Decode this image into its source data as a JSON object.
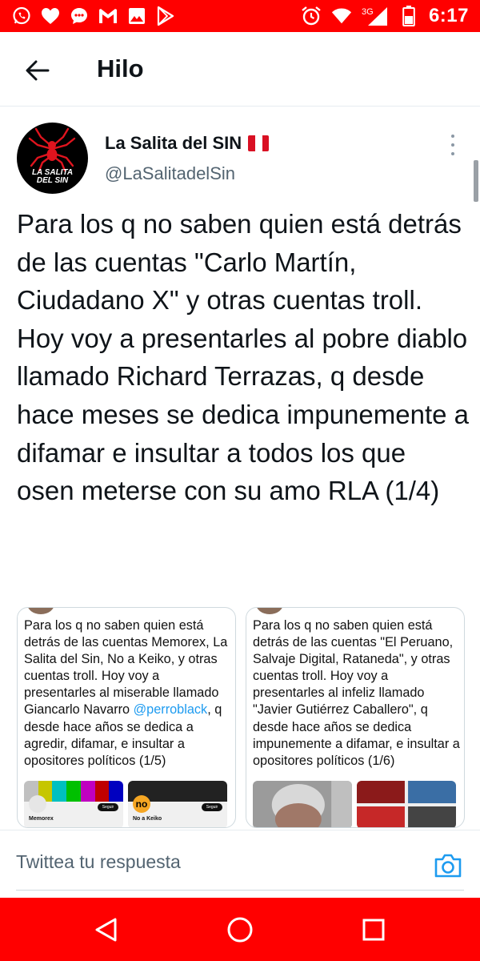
{
  "status_bar": {
    "time": "6:17",
    "network": "3G",
    "left_icons": [
      "whatsapp-icon",
      "heart-icon",
      "message-bubble-icon",
      "gmail-icon",
      "gallery-icon",
      "play-store-icon"
    ],
    "right_icons": [
      "alarm-icon",
      "wifi-icon",
      "signal-icon",
      "battery-icon"
    ],
    "bar_color": "#ff0000"
  },
  "header": {
    "title": "Hilo",
    "back_icon": "arrow-left-icon"
  },
  "tweet": {
    "avatar_label": "LA SALITA DEL SIN",
    "display_name": "La Salita del SIN",
    "handle": "@LaSalitadelSin",
    "text": "Para los q no saben quien está detrás de las cuentas \"Carlo Martín, Ciudadano X\" y otras cuentas troll. Hoy voy a presentarles al pobre diablo llamado Richard Terrazas, q desde hace meses se dedica impunemente a difamar e insultar a todos los que osen meterse con su amo RLA (1/4)"
  },
  "media": [
    {
      "text_before": "Para los q no saben quien está detrás de las cuentas Memorex, La Salita del Sin, No a Keiko, y otras cuentas troll. Hoy voy a presentarles al miserable llamado Giancarlo Navarro ",
      "link": "@perroblack",
      "text_after": ", q desde hace años se dedica a agredir, difamar, e insultar a opositores políticos (1/5)",
      "thumb1_label": "Memorex",
      "thumb2_label": "No a Keiko",
      "button_label": "Seguir"
    },
    {
      "text": "Para los q no saben quien está detrás de las cuentas \"El Peruano, Salvaje Digital, Rataneda\", y otras cuentas troll. Hoy voy a presentarles al infeliz llamado \"Javier Gutiérrez Caballero\", q desde hace años se dedica impunemente a difamar, e insultar a opositores políticos (1/6)"
    }
  ],
  "reply": {
    "placeholder": "Twittea tu respuesta",
    "camera_icon": "camera-icon"
  },
  "navigation": {
    "buttons": [
      "back-triangle-icon",
      "home-circle-icon",
      "recents-square-icon"
    ],
    "bar_color": "#ff0000"
  }
}
